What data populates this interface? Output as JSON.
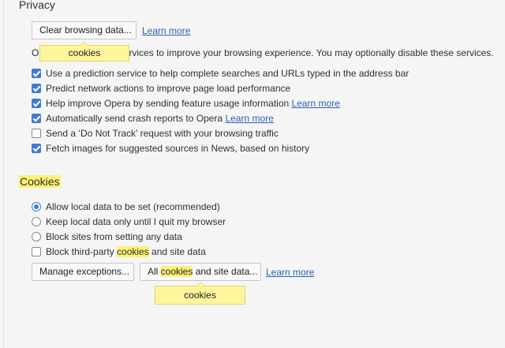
{
  "privacy": {
    "title": "Privacy",
    "clear_button": "Clear browsing data...",
    "clear_learn_more": "Learn more",
    "description": "Opera may use web services to improve your browsing experience. You may optionally disable these services.",
    "options": [
      {
        "label": "Use a prediction service to help complete searches and URLs typed in the address bar",
        "checked": true
      },
      {
        "label": "Predict network actions to improve page load performance",
        "checked": true
      },
      {
        "label": "Help improve Opera by sending feature usage information",
        "checked": true,
        "link": "Learn more"
      },
      {
        "label": "Automatically send crash reports to Opera",
        "checked": true,
        "link": "Learn more"
      },
      {
        "label": "Send a ‘Do Not Track’ request with your browsing traffic",
        "checked": false
      },
      {
        "label": "Fetch images for suggested sources in News, based on history",
        "checked": true
      }
    ],
    "tooltip": "cookies"
  },
  "cookies": {
    "title": "Cookies",
    "radios": [
      {
        "label": "Allow local data to be set (recommended)",
        "selected": true
      },
      {
        "label": "Keep local data only until I quit my browser",
        "selected": false
      },
      {
        "label": "Block sites from setting any data",
        "selected": false
      }
    ],
    "block_third_party": {
      "prefix": "Block third-party ",
      "highlight": "cookies",
      "suffix": " and site data",
      "checked": false
    },
    "manage_button": "Manage exceptions...",
    "all_button": {
      "prefix": "All ",
      "highlight": "cookies",
      "suffix": " and site data..."
    },
    "learn_more": "Learn more",
    "tooltip": "cookies"
  },
  "colors": {
    "accent": "#3b7bd6",
    "link": "#2a62b3",
    "highlight": "#fff176",
    "tooltip": "#fff59d"
  }
}
